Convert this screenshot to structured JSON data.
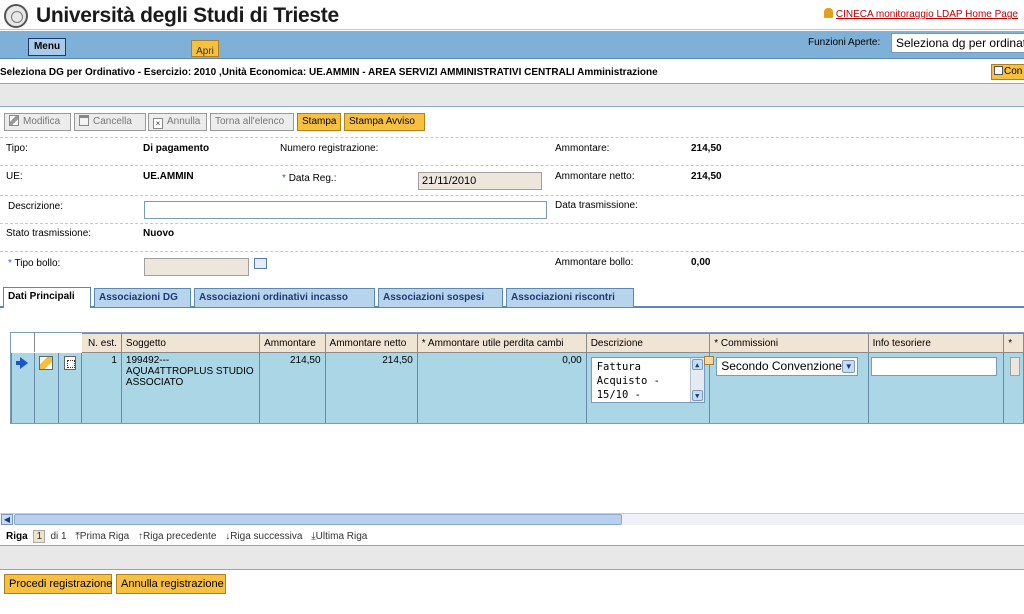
{
  "header": {
    "title": "Università degli Studi di Trieste",
    "top_link": "CINECA monitoraggio LDAP Home Page"
  },
  "menubar": {
    "menu_label": "Menu",
    "apri_label": "Apri",
    "funzioni_label": "Funzioni Aperte:",
    "funzioni_value": "Seleziona dg per ordinativo"
  },
  "breadcrumb": "Seleziona DG per Ordinativo - Esercizio: 2010 ,Unità Economica: UE.AMMIN - AREA SERVIZI AMMINISTRATIVI CENTRALI Amministrazione",
  "con_button": "Con",
  "toolbar": {
    "modifica": "Modifica",
    "cancella": "Cancella",
    "annulla": "Annulla",
    "torna": "Torna all'elenco",
    "stampa": "Stampa",
    "stampa_avviso": "Stampa Avviso"
  },
  "form": {
    "tipo_label": "Tipo:",
    "tipo_value": "Di pagamento",
    "numreg_label": "Numero registrazione:",
    "ammontare_label": "Ammontare:",
    "ammontare_value": "214,50",
    "ue_label": "UE:",
    "ue_value": "UE.AMMIN",
    "datareg_label": "Data Reg.:",
    "datareg_value": "21/11/2010",
    "ammnetto_label": "Ammontare netto:",
    "ammnetto_value": "214,50",
    "descrizione_label": "Descrizione:",
    "descrizione_value": "",
    "datatrasm_label": "Data trasmissione:",
    "statotrasm_label": "Stato trasmissione:",
    "statotrasm_value": "Nuovo",
    "tipobollo_label": "Tipo bollo:",
    "ammbollo_label": "Ammontare bollo:",
    "ammbollo_value": "0,00",
    "required_mark": "*"
  },
  "tabs": [
    {
      "label": "Dati Principali"
    },
    {
      "label": "Associazioni DG"
    },
    {
      "label": "Associazioni ordinativi incasso"
    },
    {
      "label": "Associazioni sospesi"
    },
    {
      "label": "Associazioni riscontri"
    }
  ],
  "grid": {
    "headers": {
      "nest": "N. est.",
      "soggetto": "Soggetto",
      "ammontare": "Ammontare",
      "ammnetto": "Ammontare netto",
      "perdita": "* Ammontare utile perdita cambi",
      "descrizione": "Descrizione",
      "commissioni": "* Commissioni",
      "tesoriere": "Info tesoriere",
      "extra": "*"
    },
    "row": {
      "nest": "1",
      "soggetto": "199492---AQUA4TTROPLUS STUDIO ASSOCIATO",
      "ammontare": "214,50",
      "ammnetto": "214,50",
      "perdita": "0,00",
      "descrizione": "Fattura\nAcquisto -\n15/10 -",
      "commissioni": "Secondo Convenzione",
      "tesoriere": ""
    }
  },
  "pager": {
    "riga_label": "Riga",
    "current": "1",
    "di_label": "di 1",
    "prima": "Prima Riga",
    "precedente": "Riga precedente",
    "successiva": "Riga successiva",
    "ultima": "Ultima Riga"
  },
  "footer": {
    "procedi": "Procedi registrazione",
    "annulla": "Annulla registrazione"
  },
  "colors": {
    "accent_button": "#f8c040",
    "menubar": "#7fb0d8",
    "grid_row": "#aad6e6",
    "link_red": "#c00000"
  }
}
